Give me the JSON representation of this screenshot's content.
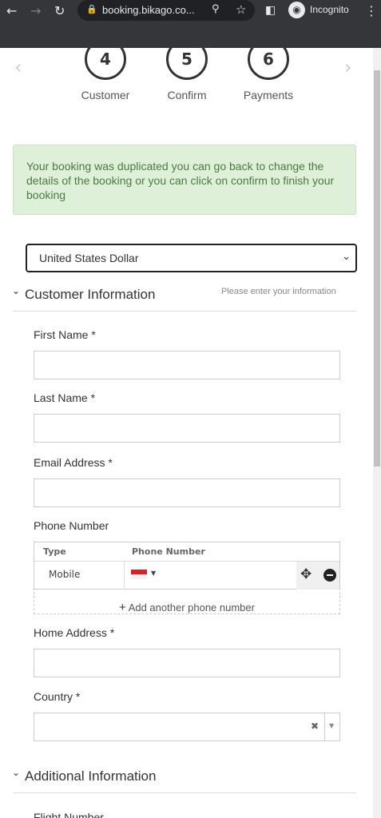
{
  "browser": {
    "url": "booking.bikago.co...",
    "incognito_label": "Incognito"
  },
  "steps": [
    {
      "number": "4",
      "label": "Customer"
    },
    {
      "number": "5",
      "label": "Confirm"
    },
    {
      "number": "6",
      "label": "Payments"
    }
  ],
  "alert": {
    "message": "Your booking was duplicated you can go back to change the details of the booking or you can click on confirm to finish your booking"
  },
  "currency": {
    "selected": "United States Dollar"
  },
  "customer_section": {
    "title": "Customer Information",
    "hint": "Please enter your information",
    "first_name_label": "First Name *",
    "last_name_label": "Last Name *",
    "email_label": "Email Address *",
    "phone_label": "Phone Number",
    "phone_table": {
      "type_header": "Type",
      "number_header": "Phone Number",
      "type_value": "Mobile"
    },
    "add_phone_label": "Add another phone number",
    "home_address_label": "Home Address *",
    "country_label": "Country *"
  },
  "additional_section": {
    "title": "Additional Information",
    "flight_number_label": "Flight Number"
  }
}
